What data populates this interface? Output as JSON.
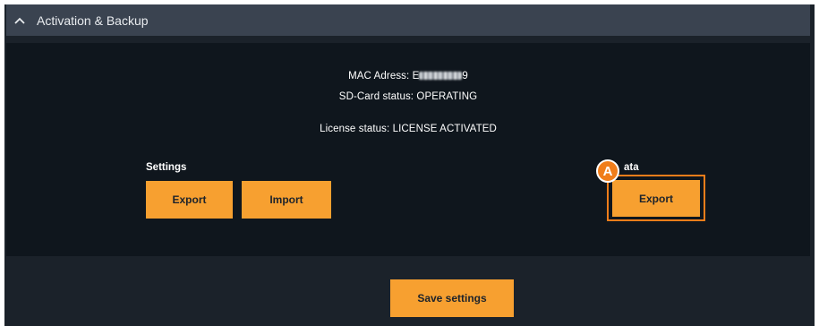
{
  "header": {
    "title": "Activation & Backup",
    "icon": "chevron-up-icon"
  },
  "status": {
    "mac_label": "MAC Adress: E",
    "mac_suffix": "9",
    "sd_card": "SD-Card status: OPERATING",
    "license": "License status: LICENSE ACTIVATED"
  },
  "settings": {
    "label": "Settings",
    "export_label": "Export",
    "import_label": "Import"
  },
  "data_section": {
    "label": "ata",
    "export_label": "Export"
  },
  "annotation": {
    "badge": "A",
    "color": "#f07d1a"
  },
  "footer": {
    "save_label": "Save settings"
  },
  "colors": {
    "accent": "#f7a030",
    "panel": "#0f161d",
    "header": "#3a4350"
  }
}
